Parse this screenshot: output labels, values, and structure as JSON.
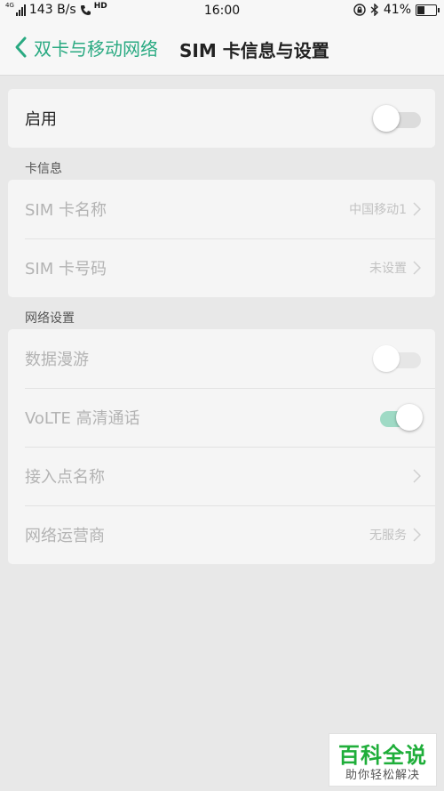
{
  "status_bar": {
    "network_tag": "4G",
    "speed": "143 B/s",
    "hd_tag": "HD",
    "time": "16:00",
    "battery_percent": "41%",
    "battery_level": 0.41
  },
  "nav": {
    "back_label": "双卡与移动网络",
    "title": "SIM 卡信息与设置"
  },
  "enable": {
    "label": "启用",
    "toggle_on": false
  },
  "card_info": {
    "section_title": "卡信息",
    "sim_name_label": "SIM 卡名称",
    "sim_name_value": "中国移动1",
    "sim_number_label": "SIM 卡号码",
    "sim_number_value": "未设置"
  },
  "network": {
    "section_title": "网络设置",
    "roaming_label": "数据漫游",
    "roaming_on": false,
    "volte_label": "VoLTE 高清通话",
    "volte_on": true,
    "apn_label": "接入点名称",
    "operator_label": "网络运营商",
    "operator_value": "无服务"
  },
  "watermark": {
    "title": "百科全说",
    "subtitle": "助你轻松解决"
  }
}
